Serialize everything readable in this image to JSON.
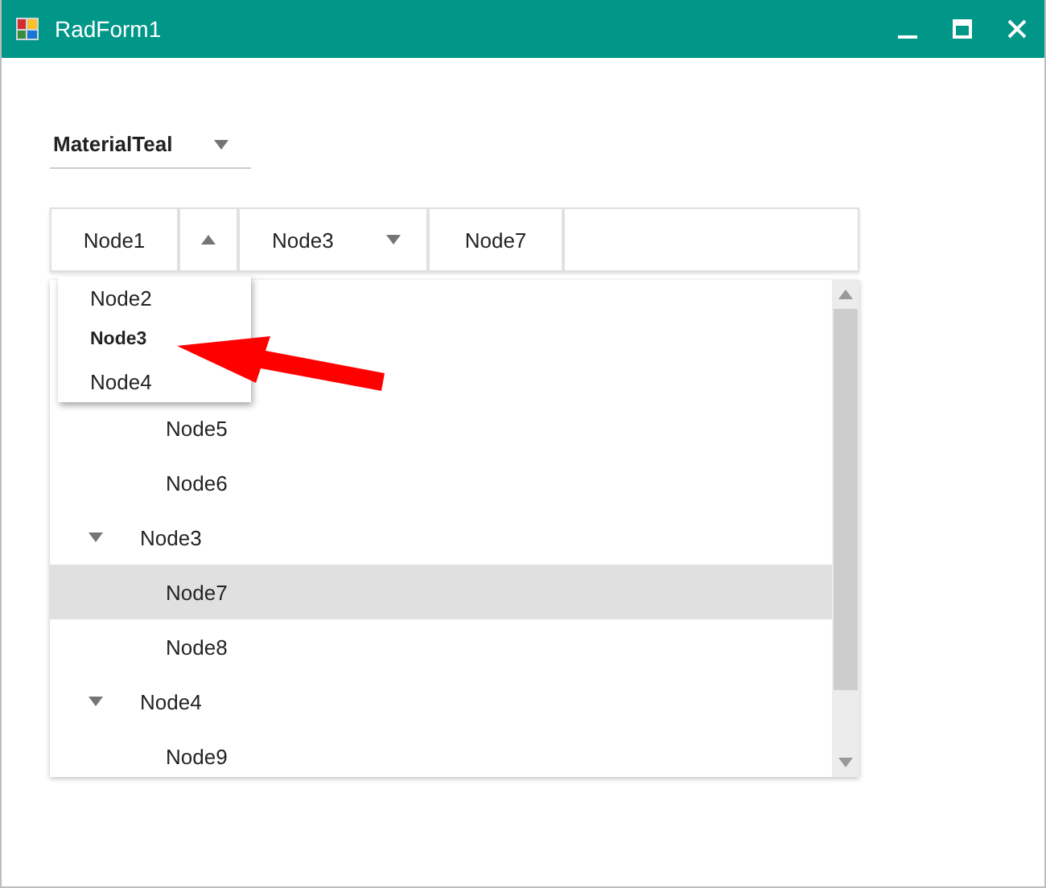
{
  "window": {
    "title": "RadForm1"
  },
  "theme_dropdown": {
    "value": "MaterialTeal"
  },
  "breadcrumb": [
    {
      "label": "Node1",
      "kind": "split",
      "expanded": true
    },
    {
      "label": "Node3",
      "kind": "dropdown",
      "expanded": false
    },
    {
      "label": "Node7",
      "kind": "plain"
    }
  ],
  "breadcrumb_popup": [
    {
      "label": "Node2",
      "selected": false
    },
    {
      "label": "Node3",
      "selected": true
    },
    {
      "label": "Node4",
      "selected": false
    }
  ],
  "tree": [
    {
      "children": [
        {
          "label": "Node5",
          "selected": false
        },
        {
          "label": "Node6",
          "selected": false
        }
      ]
    },
    {
      "label": "Node3",
      "expanded": true,
      "children": [
        {
          "label": "Node7",
          "selected": true
        },
        {
          "label": "Node8",
          "selected": false
        }
      ]
    },
    {
      "label": "Node4",
      "expanded": true,
      "children": [
        {
          "label": "Node9",
          "selected": false
        }
      ]
    }
  ]
}
